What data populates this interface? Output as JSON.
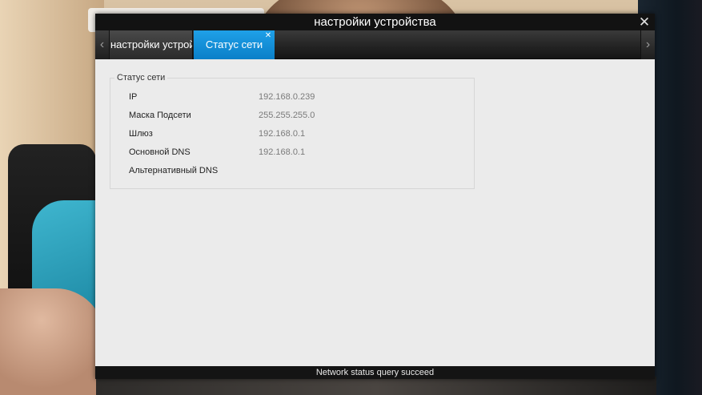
{
  "window": {
    "title": "настройки устройства",
    "close_glyph": "✕"
  },
  "tabs": {
    "prev_glyph": "‹",
    "next_glyph": "›",
    "items": [
      {
        "label": "настройки устройства",
        "active": false
      },
      {
        "label": "Статус сети",
        "active": true,
        "close_glyph": "✕"
      }
    ]
  },
  "network_status": {
    "group_title": "Статус сети",
    "rows": [
      {
        "label": "IP",
        "value": "192.168.0.239"
      },
      {
        "label": "Маска Подсети",
        "value": "255.255.255.0"
      },
      {
        "label": "Шлюз",
        "value": "192.168.0.1"
      },
      {
        "label": "Основной DNS",
        "value": "192.168.0.1"
      },
      {
        "label": "Альтернативный DNS",
        "value": ""
      }
    ]
  },
  "statusbar": {
    "message": "Network status query succeed"
  },
  "colors": {
    "active_tab": "#0a8fd8",
    "titlebar": "#121212",
    "content_bg": "#ebebeb"
  }
}
